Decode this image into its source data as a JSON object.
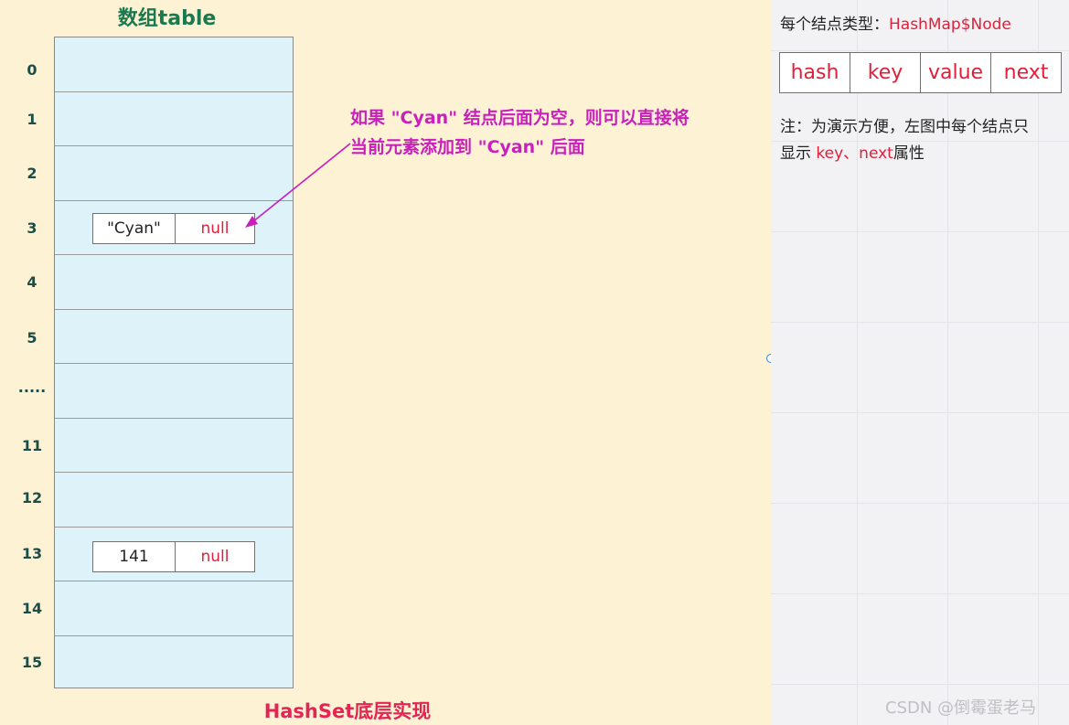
{
  "colors": {
    "canvas_bg": "#fdf3d4",
    "array_fill": "#def2fa",
    "title_green": "#1a7a4f",
    "annotation_magenta": "#c91fbd",
    "caption_red": "#e32454",
    "null_red": "#e0203a"
  },
  "array": {
    "title": "数组table",
    "indices": [
      "0",
      "1",
      "2",
      "3",
      "4",
      "5",
      ".....",
      "11",
      "12",
      "13",
      "14",
      "15"
    ],
    "nodes": [
      {
        "key": "\"Cyan\"",
        "next": "null"
      },
      {
        "key": "141",
        "next": "null"
      }
    ]
  },
  "annotation": {
    "line1": "如果 \"Cyan\" 结点后面为空，则可以直接将",
    "line2": "当前元素添加到 \"Cyan\" 后面"
  },
  "caption": "HashSet底层实现",
  "legend": {
    "type_prefix": "每个结点类型：",
    "type_name": "HashMap$Node",
    "fields": [
      "hash",
      "key",
      "value",
      "next"
    ],
    "note_line1": "注：为演示方便，左图中每个结点只",
    "note_prefix": "显示 ",
    "note_highlight": "key、next",
    "note_suffix": "属性"
  },
  "watermark": "CSDN @倒霉蛋老马"
}
